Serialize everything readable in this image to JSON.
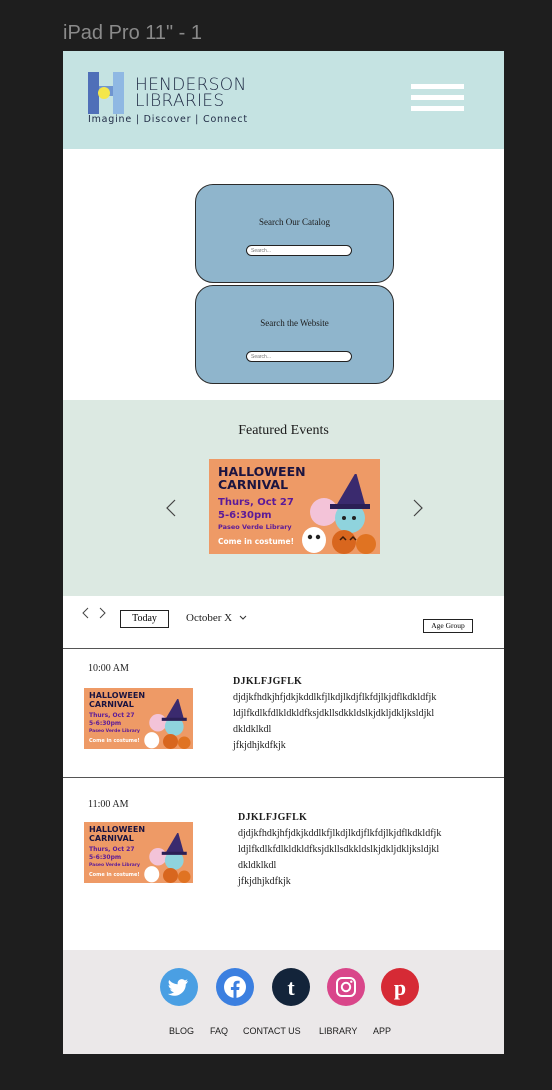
{
  "frame_label": "iPad Pro 11\" - 1",
  "header": {
    "logo_line1": "HENDERSON",
    "logo_line2": "LIBRARIES",
    "tagline": "Imagine | Discover | Connect",
    "menu_icon": "hamburger-menu-icon"
  },
  "search": {
    "catalog_title": "Search Our Catalog",
    "catalog_placeholder": "Search...",
    "website_title": "Search the Website",
    "website_placeholder": "Search..."
  },
  "featured": {
    "title": "Featured Events",
    "prev_icon": "chevron-left-icon",
    "next_icon": "chevron-right-icon",
    "banner": {
      "title_line1": "HALLOWEEN",
      "title_line2": "CARNIVAL",
      "date": "Thurs, Oct 27",
      "time": "5-6:30pm",
      "place": "Paseo Verde Library",
      "note": "Come in costume!"
    }
  },
  "calendar": {
    "prev_icon": "chevron-left-icon",
    "next_icon": "chevron-right-icon",
    "today_label": "Today",
    "month_label": "October X",
    "age_group_label": "Age Group"
  },
  "events": [
    {
      "time": "10:00 AM",
      "name": "DJKLFJGFLK",
      "desc_lines": [
        "djdjkfhdkjhfjdkjkddlkfjlkdjlkdjflkfdjlkjdflkdkldfjk",
        "ldjlfkdlkfdlkldkldfksjdkllsdkkldslkjdkljdkljksldjkl",
        "dkldklkdl"
      ],
      "desc_last": "jfkjdhjkdfkjk",
      "banner": {
        "title_line1": "HALLOWEEN",
        "title_line2": "CARNIVAL",
        "date": "Thurs, Oct 27",
        "time": "5-6:30pm",
        "place": "Paseo Verde Library",
        "note": "Come in costume!"
      }
    },
    {
      "time": "11:00 AM",
      "name": "DJKLFJGFLK",
      "desc_lines": [
        "djdjkfhdkjhfjdkjkddlkfjlkdjlkdjflkfdjlkjdflkdkldfjk",
        "ldjlfkdlkfdlkldkldfksjdkllsdkkldslkjdkljdkljksldjkl",
        "dkldklkdl"
      ],
      "desc_last": "jfkjdhjkdfkjk",
      "banner": {
        "title_line1": "HALLOWEEN",
        "title_line2": "CARNIVAL",
        "date": "Thurs, Oct 27",
        "time": "5-6:30pm",
        "place": "Paseo Verde Library",
        "note": "Come in costume!"
      }
    }
  ],
  "footer": {
    "social": [
      "twitter-icon",
      "facebook-icon",
      "tumblr-icon",
      "instagram-icon",
      "pinterest-icon"
    ],
    "links": [
      "BLOG",
      "FAQ",
      "CONTACT US",
      "LIBRARY",
      "APP"
    ]
  },
  "colors": {
    "header_bg": "#c5e3e2",
    "search_box": "#8fb5cc",
    "featured_bg": "#dce9e2",
    "footer_bg": "#ebe8e9",
    "banner_orange": "#ee9a66",
    "twitter": "#4a9fe3",
    "facebook": "#3b7fe0",
    "tumblr": "#13243a",
    "instagram": "#d9468a",
    "pinterest": "#d62a35"
  }
}
